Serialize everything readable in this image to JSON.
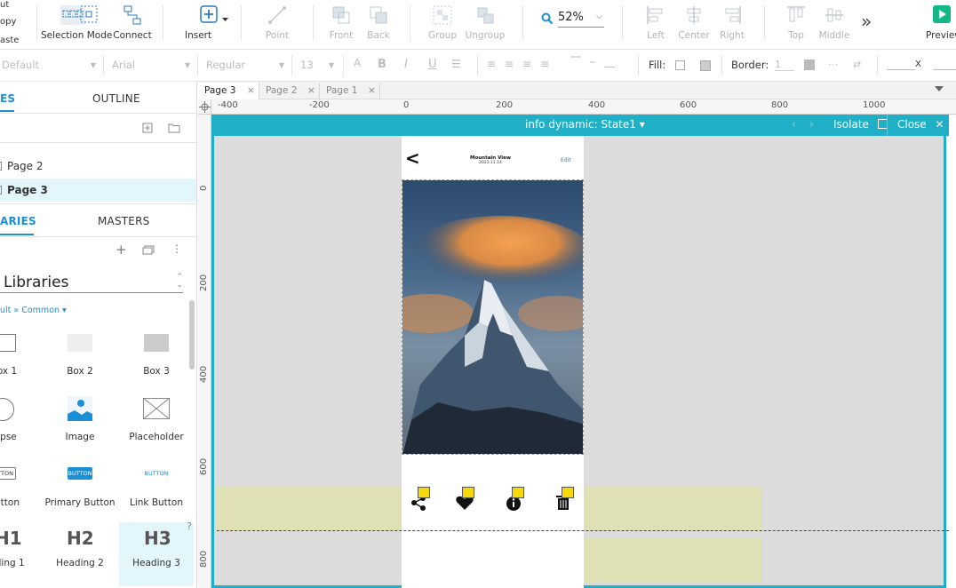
{
  "toolbar": {
    "edit_items": [
      "ut",
      "opy",
      "aste"
    ],
    "selection_mode": "Selection Mode",
    "connect": "Connect",
    "insert": "Insert",
    "point": "Point",
    "front": "Front",
    "back": "Back",
    "group": "Group",
    "ungroup": "Ungroup",
    "zoom": "52%",
    "left": "Left",
    "center": "Center",
    "right": "Right",
    "top": "Top",
    "middle": "Middle",
    "more": "»",
    "preview": "Preview"
  },
  "format": {
    "style": "Default",
    "font": "Arial",
    "weight": "Regular",
    "size": "13",
    "fill_label": "Fill:",
    "border_label": "Border:",
    "border_value": "1",
    "x_label": "X"
  },
  "left_panel": {
    "tab_pages": "ES",
    "tab_outline": "OUTLINE",
    "pages": [
      "Page 2",
      "Page 3"
    ],
    "tab_libraries": "ARIES",
    "tab_masters": "MASTERS",
    "library_name": "Libraries",
    "library_path": "ult » Common ▾",
    "widgets": [
      {
        "label": "ox 1"
      },
      {
        "label": "Box 2"
      },
      {
        "label": "Box 3"
      },
      {
        "label": "ipse"
      },
      {
        "label": "Image"
      },
      {
        "label": "Placeholder"
      },
      {
        "label": "utton"
      },
      {
        "label": "Primary Button"
      },
      {
        "label": "Link Button"
      },
      {
        "label": "ading 1"
      },
      {
        "label": "Heading 2"
      },
      {
        "label": "Heading 3"
      }
    ],
    "heading_glyphs": [
      "H1",
      "H2",
      "H3"
    ],
    "button_glyphs": [
      "TTON",
      "BUTTON",
      "BUTTON"
    ],
    "help": "?"
  },
  "doc_tabs": [
    {
      "label": "Page 3",
      "active": true
    },
    {
      "label": "Page 2",
      "active": false
    },
    {
      "label": "Page 1",
      "active": false
    }
  ],
  "ruler": {
    "h": [
      "-400",
      "-200",
      "0",
      "200",
      "400",
      "600",
      "800",
      "1000"
    ],
    "v": [
      "0",
      "200",
      "400",
      "600",
      "800"
    ]
  },
  "isolate": {
    "state_label": "info dynamic:",
    "state_value": "State1 ▾",
    "isolate": "Isolate",
    "close": "Close"
  },
  "phone": {
    "title": "Mountain View",
    "date": "2023.11.14",
    "edit": "Edit",
    "back": "<"
  },
  "colors": {
    "accent": "#1fb0c8",
    "link": "#1a8fd6",
    "highlight": "#dfe0b5",
    "bolt": "#f5d90a",
    "preview": "#12b886"
  }
}
